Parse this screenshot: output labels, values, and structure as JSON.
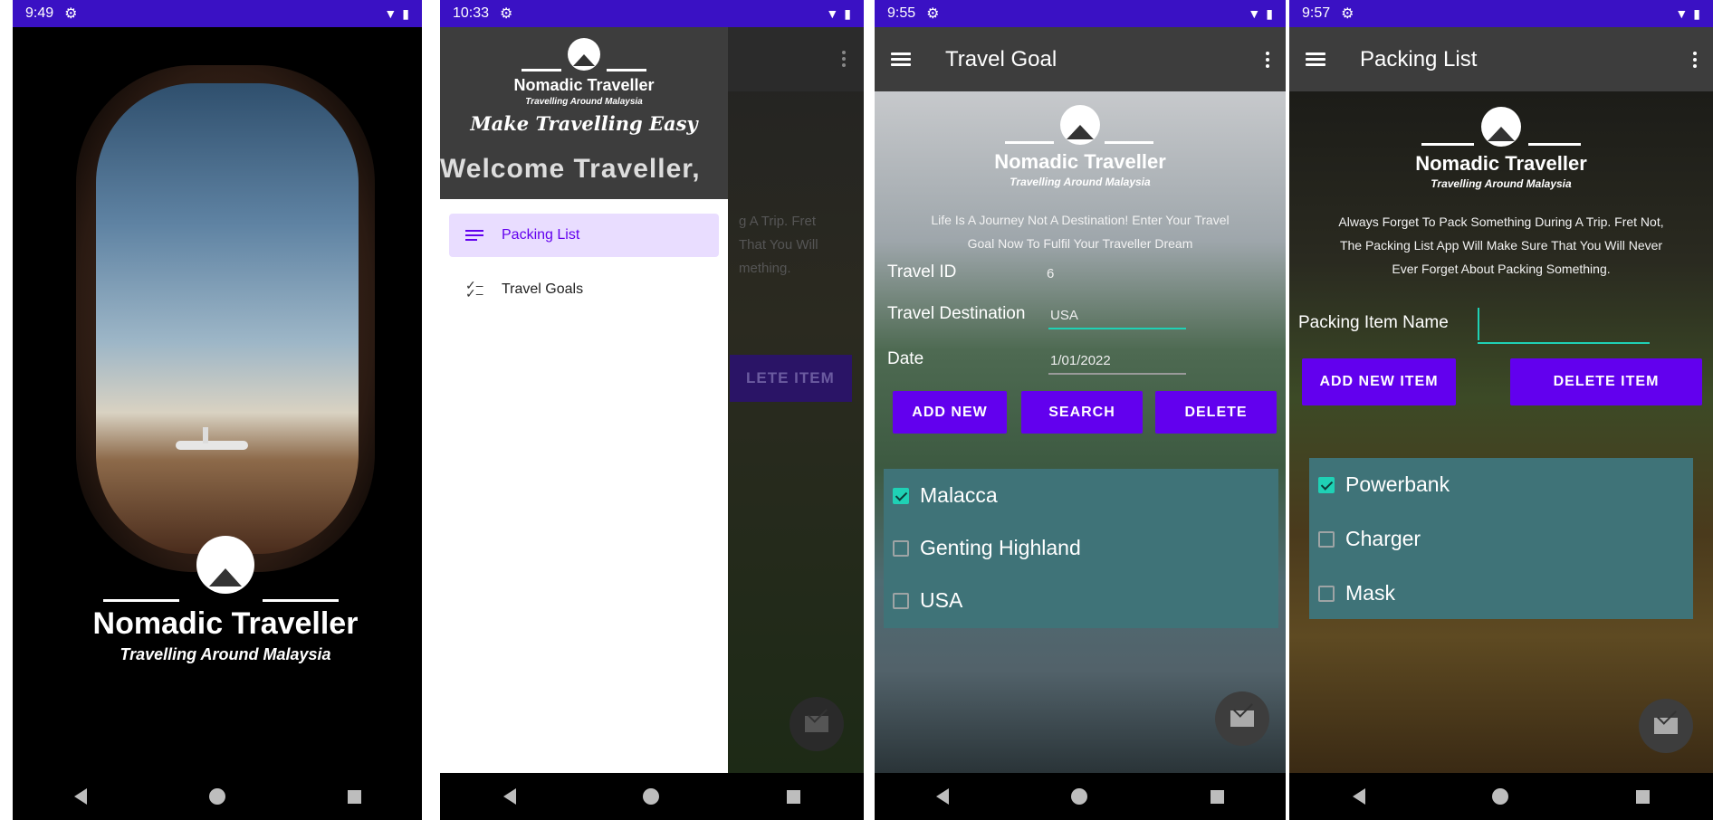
{
  "colors": {
    "status_bar": "#3a11c4",
    "app_bar": "#3d3d3d",
    "button": "#6200ee",
    "accent": "#1fd1b5",
    "list_panel": "#3f7378",
    "drawer_highlight": "#e9ddff",
    "drawer_text": "#6200ee"
  },
  "screen1": {
    "time": "9:49",
    "logo_name": "Nomadic Traveller",
    "logo_sub": "Travelling Around Malaysia"
  },
  "screen2": {
    "time": "10:33",
    "logo_name": "Nomadic Traveller",
    "logo_sub": "Travelling Around Malaysia",
    "tagline": "Make Travelling Easy",
    "welcome": "Welcome Traveller,",
    "menu": [
      {
        "label": "Packing List",
        "icon": "list-icon"
      },
      {
        "label": "Travel Goals",
        "icon": "checklist-icon"
      }
    ],
    "bg_hint_lines": [
      "g A Trip. Fret",
      "That You Will",
      "mething."
    ],
    "bg_hint_button": "LETE ITEM"
  },
  "screen3": {
    "time": "9:55",
    "title": "Travel Goal",
    "logo_name": "Nomadic Traveller",
    "logo_sub": "Travelling Around Malaysia",
    "description": "Life Is A Journey Not A Destination! Enter Your Travel Goal Now To Fulfil Your Traveller Dream",
    "fields": [
      {
        "label": "Travel ID",
        "value": "6"
      },
      {
        "label": "Travel Destination",
        "value": "USA"
      },
      {
        "label": "Date",
        "value": "1/01/2022"
      }
    ],
    "buttons": [
      "ADD NEW",
      "SEARCH",
      "DELETE"
    ],
    "items": [
      {
        "label": "Malacca",
        "checked": true
      },
      {
        "label": "Genting Highland",
        "checked": false
      },
      {
        "label": "USA",
        "checked": false
      }
    ]
  },
  "screen4": {
    "time": "9:57",
    "title": "Packing List",
    "logo_name": "Nomadic Traveller",
    "logo_sub": "Travelling Around Malaysia",
    "description": "Always Forget To Pack Something During A Trip. Fret Not, The Packing List App Will Make Sure That You Will Never Ever Forget About Packing Something.",
    "field_label": "Packing Item Name",
    "field_value": "",
    "buttons": [
      "ADD NEW ITEM",
      "DELETE ITEM"
    ],
    "items": [
      {
        "label": "Powerbank",
        "checked": true
      },
      {
        "label": "Charger",
        "checked": false
      },
      {
        "label": "Mask",
        "checked": false
      }
    ]
  }
}
